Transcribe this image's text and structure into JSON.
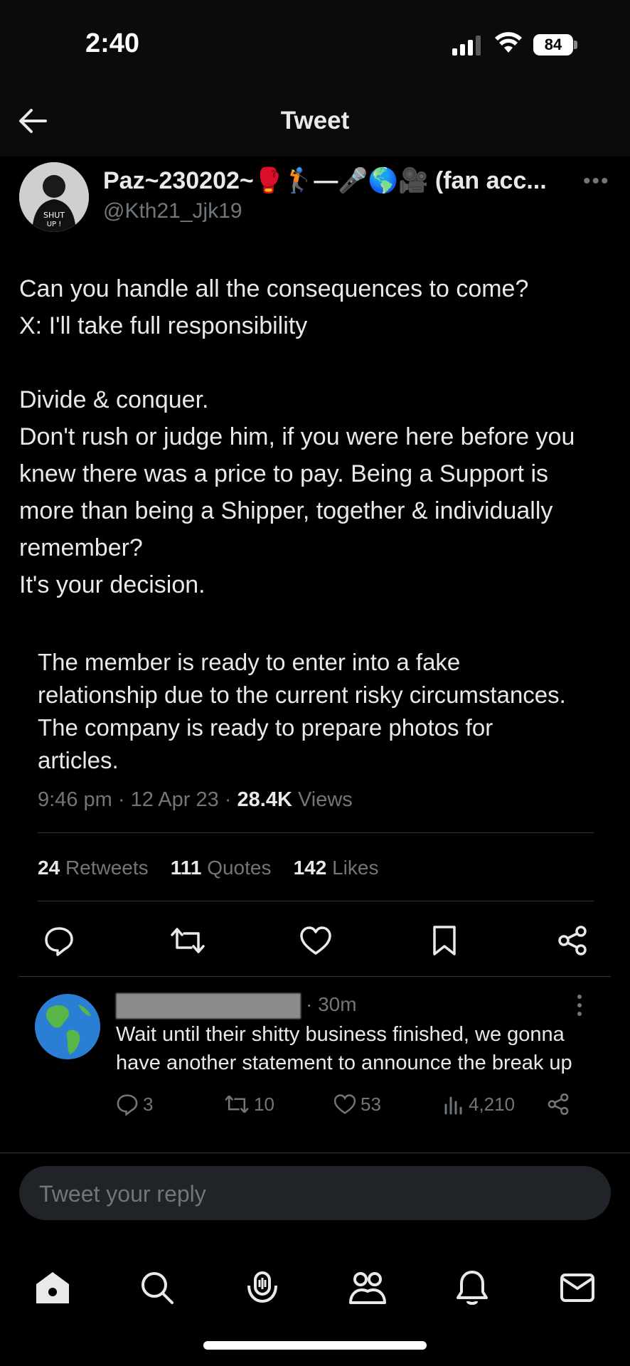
{
  "status": {
    "time": "2:40",
    "battery": "84"
  },
  "nav": {
    "title": "Tweet"
  },
  "tweet": {
    "author": "Paz~230202~🥊🏌—🎤🌎🎥 (fan acc...",
    "handle": "@Kth21_Jjk19",
    "text": "Can you handle all the consequences to come?\nX: I'll take full responsibility\n\nDivide & conquer.\nDon't rush or judge him, if you were here before you knew there was a price to pay. Being a Support is more than being a Shipper, together & individually remember?\nIt's your decision.",
    "quote_text": "The member is ready to enter into a fake relationship due to the current risky circumstances. The company is ready to prepare photos for articles.",
    "meta": {
      "time": "9:46 pm",
      "date": "12 Apr 23",
      "views_count": "28.4K",
      "views_label": "Views"
    },
    "stats": {
      "retweets": "24",
      "retweets_label": "Retweets",
      "quotes": "111",
      "quotes_label": "Quotes",
      "likes": "142",
      "likes_label": "Likes"
    }
  },
  "reply": {
    "time": "· 30m",
    "text": "Wait until their shitty business finished, we gonna have another statement to announce the break up",
    "replies": "3",
    "retweets": "10",
    "likes": "53",
    "views": "4,210"
  },
  "composer": {
    "placeholder": "Tweet your reply"
  },
  "icons": {
    "tabs": [
      "home-icon",
      "search-icon",
      "spaces-icon",
      "communities-icon",
      "notifications-icon",
      "messages-icon"
    ]
  }
}
